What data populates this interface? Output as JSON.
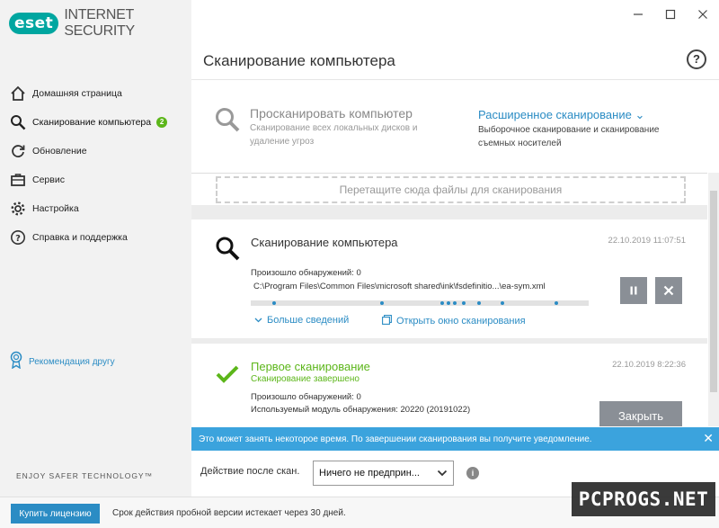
{
  "app": {
    "brand": "eset",
    "product": "INTERNET SECURITY",
    "accent_color": "#2b8cc4",
    "success_color": "#5cb61a",
    "brand_color": "#00a6a0"
  },
  "window_controls": {
    "minimize": "—",
    "maximize": "☐",
    "close": "✕"
  },
  "sidebar": {
    "items": [
      {
        "label": "Домашняя страница",
        "icon": "home-icon"
      },
      {
        "label": "Сканирование компьютера",
        "icon": "search-icon",
        "badge": "2",
        "active": true
      },
      {
        "label": "Обновление",
        "icon": "refresh-icon"
      },
      {
        "label": "Сервис",
        "icon": "briefcase-icon"
      },
      {
        "label": "Настройка",
        "icon": "gear-icon"
      },
      {
        "label": "Справка и поддержка",
        "icon": "help-icon"
      }
    ],
    "recommend": "Рекомендация другу",
    "tagline": "ENJOY SAFER TECHNOLOGY™"
  },
  "header": {
    "title": "Сканирование компьютера",
    "help": "?"
  },
  "scan_options": {
    "computer": {
      "title": "Просканировать компьютер",
      "desc1": "Сканирование всех локальных дисков и",
      "desc2": "удаление угроз"
    },
    "advanced": {
      "title": "Расширенное сканирование",
      "chevron": "⌄",
      "desc1": "Выборочное сканирование и сканирование",
      "desc2": "съемных носителей"
    }
  },
  "dropzone": "Перетащите сюда файлы для сканирования",
  "scans": [
    {
      "title": "Сканирование компьютера",
      "date": "22.10.2019 11:07:51",
      "detections": "Произошло обнаружений: 0",
      "path": "C:\\Program Files\\Common Files\\microsoft shared\\ink\\fsdefinitio...\\ea-sym.xml",
      "pause": "⏸",
      "stop": "✕",
      "more": "Больше сведений",
      "open_window": "Открыть окно сканирования"
    },
    {
      "title": "Первое сканирование",
      "status": "Сканирование завершено",
      "date": "22.10.2019 8:22:36",
      "detections": "Произошло обнаружений: 0",
      "module": "Используемый модуль обнаружения: 20220 (20191022)",
      "close": "Закрыть"
    }
  ],
  "notification": {
    "text": "Это может занять некоторое время. По завершении сканирования вы получите уведомление.",
    "close": "✕"
  },
  "after_scan": {
    "label": "Действие после скан.",
    "value": "Ничего не предприн...",
    "info": "i"
  },
  "footer": {
    "buy": "Купить лицензию",
    "trial": "Срок действия пробной версии истекает через 30 дней."
  },
  "watermark": "PCPROGS.NET"
}
